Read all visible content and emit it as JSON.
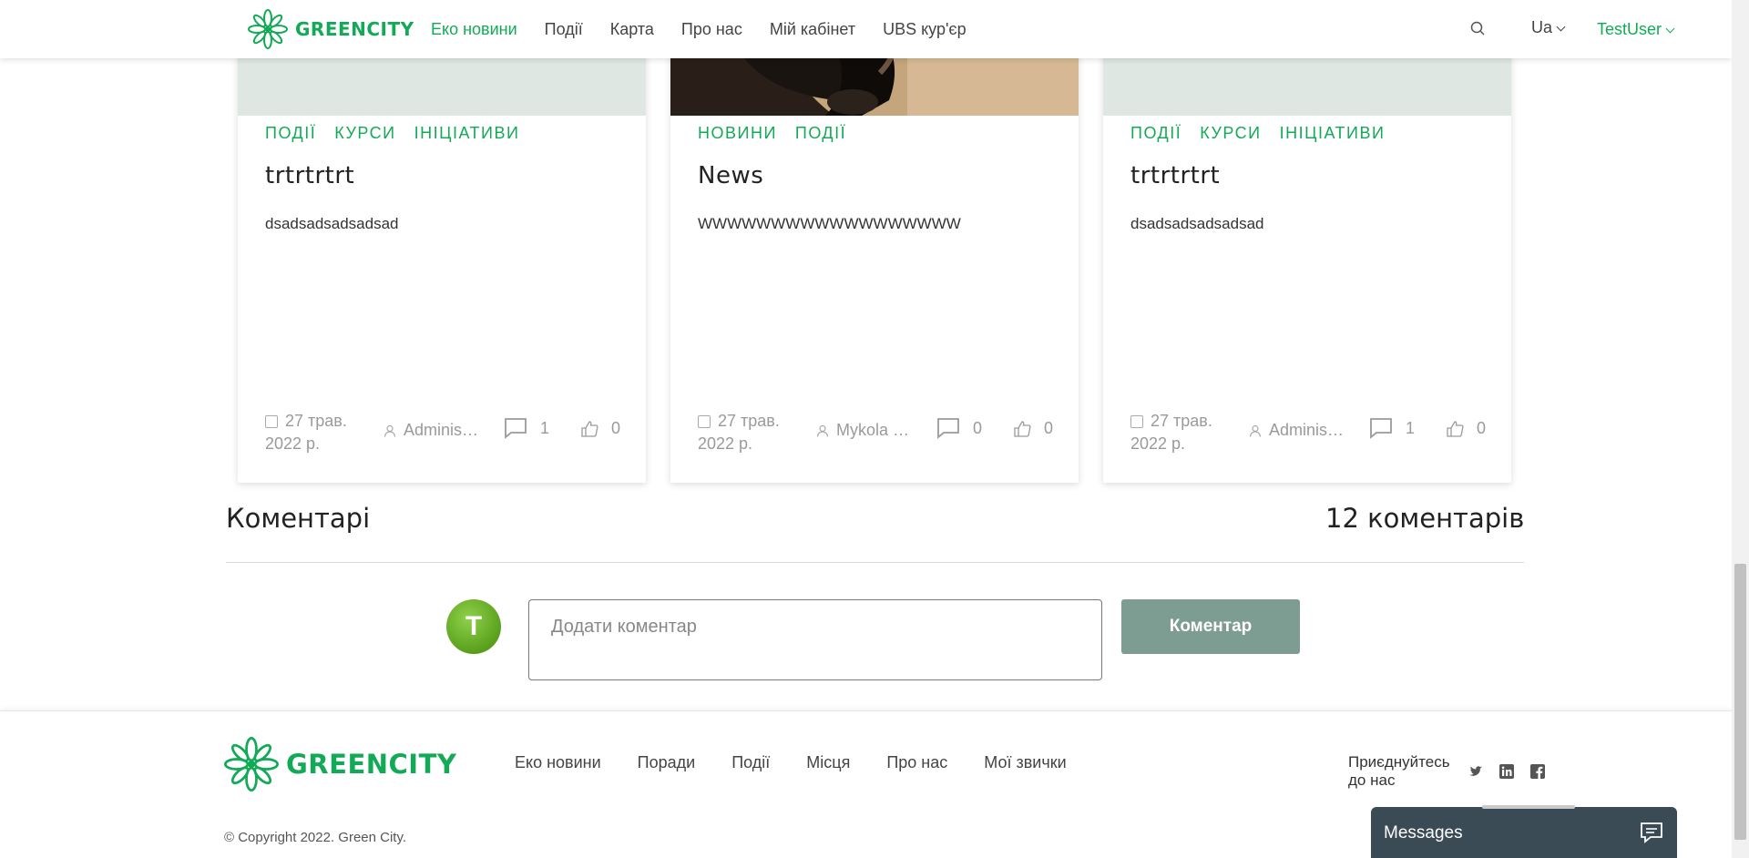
{
  "header": {
    "logo_text": "GREENCITY",
    "nav": [
      "Еко новини",
      "Події",
      "Карта",
      "Про нас",
      "Мій кабінет",
      "UBS кур'єр"
    ],
    "lang": "Ua",
    "user": "TestUser"
  },
  "cards": [
    {
      "tags": [
        "ПОДІЇ",
        "КУРСИ",
        "ІНІЦІАТИВИ"
      ],
      "title": "trtrtrtrt",
      "text": "dsadsadsadsadsad",
      "date": "27 трав. 2022 р.",
      "author": "Adminis…",
      "comments": "1",
      "likes": "0"
    },
    {
      "tags": [
        "НОВИНИ",
        "ПОДІЇ"
      ],
      "title": "News",
      "text": "WWWWWWWWWWWWWWWWWW",
      "date": "27 трав. 2022 р.",
      "author": "Mykola …",
      "comments": "0",
      "likes": "0"
    },
    {
      "tags": [
        "ПОДІЇ",
        "КУРСИ",
        "ІНІЦІАТИВИ"
      ],
      "title": "trtrtrtrt",
      "text": "dsadsadsadsadsad",
      "date": "27 трав. 2022 р.",
      "author": "Adminis…",
      "comments": "1",
      "likes": "0"
    }
  ],
  "comments": {
    "title": "Коментарі",
    "count": "12 коментарів",
    "avatar_letter": "T",
    "placeholder": "Додати коментар",
    "button": "Коментар"
  },
  "footer": {
    "logo_text": "GREENCITY",
    "nav": [
      "Еко новини",
      "Поради",
      "Події",
      "Місця",
      "Про нас",
      "Мої звички"
    ],
    "join_text": "Приєднуйтесь до нас",
    "copyright": "© Copyright 2022. Green City."
  },
  "messages": {
    "label": "Messages"
  },
  "colors": {
    "brand": "#13aa57",
    "button": "#7d9c92",
    "widget": "#3a4b55"
  }
}
